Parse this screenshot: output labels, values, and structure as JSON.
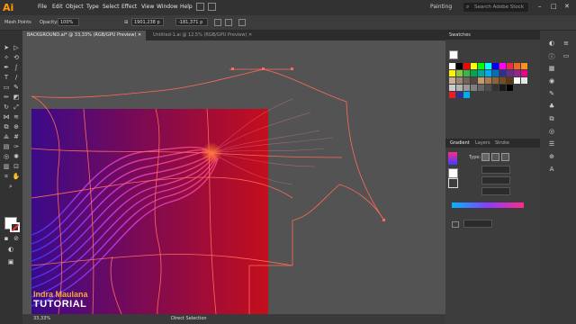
{
  "app": {
    "logo": "Ai"
  },
  "menu": [
    "File",
    "Edit",
    "Object",
    "Type",
    "Select",
    "Effect",
    "View",
    "Window",
    "Help"
  ],
  "workspace": "Painting",
  "search": {
    "placeholder": "Search Adobe Stock"
  },
  "control_bar": {
    "tool_name": "Mesh Points",
    "opacity_label": "Opacity:",
    "opacity_value": "100%",
    "x_value": "1901,238 p",
    "y_value": "-181,371 p"
  },
  "tabs": [
    {
      "label": "BACKGROUND.ai* @ 33,33% (RGB/GPU Preview)",
      "active": true
    },
    {
      "label": "Untitled-1.ai @ 12,5% (RGB/GPU Preview)",
      "active": false
    }
  ],
  "status": {
    "zoom": "33,33%",
    "tool": "Direct Selection"
  },
  "panels": {
    "swatches": {
      "title": "Swatches"
    },
    "gradient_tabs": [
      "Gradient",
      "Layers",
      "Stroke"
    ],
    "gradient_type_label": "Type:"
  },
  "watermark": {
    "name": "Indra Maulana",
    "subtitle": "TUTORIAL"
  },
  "colors": {
    "accent": "#ff9a00",
    "mesh_line": "#ff6a5a",
    "gradient_start": "#00b4ff",
    "gradient_end": "#ff2a8a"
  }
}
